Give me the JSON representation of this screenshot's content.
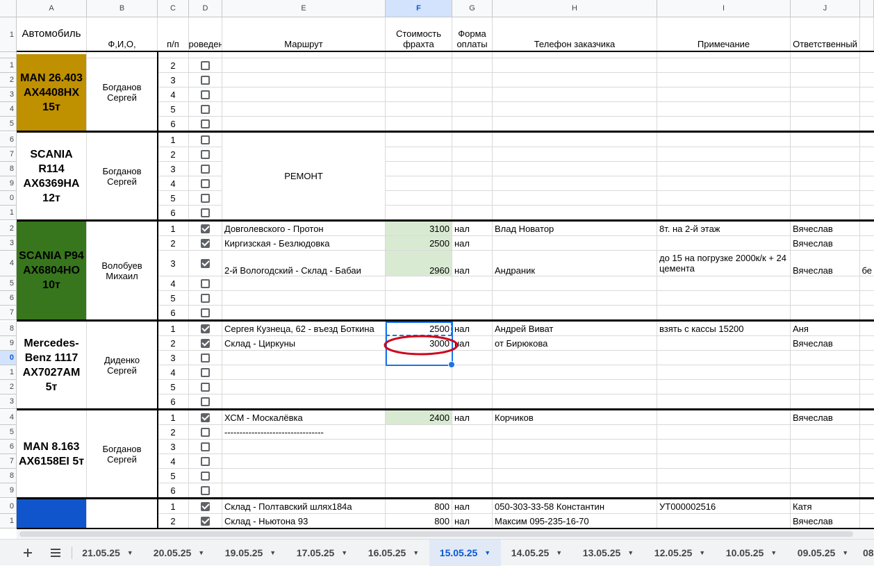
{
  "columns": [
    "A",
    "B",
    "C",
    "D",
    "E",
    "F",
    "G",
    "H",
    "I",
    "J"
  ],
  "selected_column": "F",
  "header": {
    "a": "Автомобиль",
    "b": "Ф,И,О,",
    "c": "п/п",
    "d": "Проведено",
    "e": "Маршрут",
    "f": "Стоимость фрахта",
    "g": "Форма оплаты",
    "h": "Телефон заказчика",
    "i": "Примечание",
    "j": "Ответственный",
    "row_label": "1"
  },
  "row_numbers": [
    "1",
    "1",
    "2",
    "3",
    "4",
    "5",
    "6",
    "7",
    "8",
    "9",
    "0",
    "1",
    "2",
    "3",
    "4",
    "5",
    "6",
    "7",
    "8",
    "9",
    "0",
    "1",
    "2",
    "3",
    "4",
    "5",
    "6",
    "7",
    "8",
    "9",
    "0",
    "1",
    "2"
  ],
  "selected_row_label": "0",
  "groups": [
    {
      "vehicle": "MAN 26.403 АХ4408НХ 15т",
      "vehicle_color": "#bf9000",
      "driver": "Богданов Сергей",
      "rows": [
        {
          "n": "2",
          "done": false,
          "route": "",
          "cost": "",
          "pay": "",
          "phone": "",
          "note": "",
          "resp": ""
        },
        {
          "n": "3",
          "done": false,
          "route": "",
          "cost": "",
          "pay": "",
          "phone": "",
          "note": "",
          "resp": ""
        },
        {
          "n": "4",
          "done": false,
          "route": "",
          "cost": "",
          "pay": "",
          "phone": "",
          "note": "",
          "resp": ""
        },
        {
          "n": "5",
          "done": false,
          "route": "",
          "cost": "",
          "pay": "",
          "phone": "",
          "note": "",
          "resp": ""
        },
        {
          "n": "6",
          "done": false,
          "route": "",
          "cost": "",
          "pay": "",
          "phone": "",
          "note": "",
          "resp": ""
        }
      ]
    },
    {
      "vehicle": "SCANIA R114 АХ6369НА 12т",
      "vehicle_color": "#ffffff",
      "driver": "Богданов Сергей",
      "merged_route": "РЕМОНТ",
      "rows": [
        {
          "n": "1",
          "done": false,
          "cost": "",
          "pay": "",
          "phone": "",
          "note": "",
          "resp": ""
        },
        {
          "n": "2",
          "done": false,
          "cost": "",
          "pay": "",
          "phone": "",
          "note": "",
          "resp": ""
        },
        {
          "n": "3",
          "done": false,
          "cost": "",
          "pay": "",
          "phone": "",
          "note": "",
          "resp": ""
        },
        {
          "n": "4",
          "done": false,
          "cost": "",
          "pay": "",
          "phone": "",
          "note": "",
          "resp": ""
        },
        {
          "n": "5",
          "done": false,
          "cost": "",
          "pay": "",
          "phone": "",
          "note": "",
          "resp": ""
        },
        {
          "n": "6",
          "done": false,
          "cost": "",
          "pay": "",
          "phone": "",
          "note": "",
          "resp": ""
        }
      ]
    },
    {
      "vehicle": "SCANIA P94 АХ6804НО 10т",
      "vehicle_color": "#38761d",
      "driver": "Волобуев Михаил",
      "rows": [
        {
          "n": "1",
          "done": true,
          "route": "Довголевского - Протон",
          "cost": "3100",
          "pay": "нал",
          "phone": "Влад Новатор",
          "note": "8т. на 2-й этаж",
          "resp": "Вячеслав"
        },
        {
          "n": "2",
          "done": true,
          "route": "Киргизская - Безлюдовка",
          "cost": "2500",
          "pay": "нал",
          "phone": "",
          "note": "",
          "resp": "Вячеслав"
        },
        {
          "n": "3",
          "done": true,
          "route": "2-й Вологодский - Склад - Бабаи",
          "cost": "2960",
          "pay": "нал",
          "phone": "Андраник",
          "note": "до 15 на погрузке 2000к/к + 24 цемента",
          "resp": "Вячеслав",
          "overflow": "бе"
        },
        {
          "n": "4",
          "done": false,
          "route": "",
          "cost": "",
          "pay": "",
          "phone": "",
          "note": "",
          "resp": ""
        },
        {
          "n": "5",
          "done": false,
          "route": "",
          "cost": "",
          "pay": "",
          "phone": "",
          "note": "",
          "resp": ""
        },
        {
          "n": "6",
          "done": false,
          "route": "",
          "cost": "",
          "pay": "",
          "phone": "",
          "note": "",
          "resp": ""
        }
      ]
    },
    {
      "vehicle": "Mercedes-Benz 1117 АХ7027АМ 5т",
      "vehicle_color": "#ffffff",
      "driver": "Диденко Сергей",
      "rows": [
        {
          "n": "1",
          "done": true,
          "route": "Сергея Кузнеца, 62 - въезд Боткина",
          "cost": "2500",
          "pay": "нал",
          "phone": "Андрей Виват",
          "note": "взять с кассы 15200",
          "resp": "Аня"
        },
        {
          "n": "2",
          "done": true,
          "route": "Склад - Циркуны",
          "cost": "3000",
          "pay": "нал",
          "phone": "от Бирюкова",
          "note": "",
          "resp": "Вячеслав"
        },
        {
          "n": "3",
          "done": false,
          "route": "",
          "cost": "",
          "pay": "",
          "phone": "",
          "note": "",
          "resp": ""
        },
        {
          "n": "4",
          "done": false,
          "route": "",
          "cost": "",
          "pay": "",
          "phone": "",
          "note": "",
          "resp": ""
        },
        {
          "n": "5",
          "done": false,
          "route": "",
          "cost": "",
          "pay": "",
          "phone": "",
          "note": "",
          "resp": ""
        },
        {
          "n": "6",
          "done": false,
          "route": "",
          "cost": "",
          "pay": "",
          "phone": "",
          "note": "",
          "resp": ""
        }
      ]
    },
    {
      "vehicle": "MAN 8.163 АХ6158ЕІ 5т",
      "vehicle_color": "#ffffff",
      "driver": "Богданов Сергей",
      "rows": [
        {
          "n": "1",
          "done": true,
          "route": "ХСМ - Москалёвка",
          "cost": "2400",
          "pay": "нал",
          "phone": "Корчиков",
          "note": "",
          "resp": "Вячеслав"
        },
        {
          "n": "2",
          "done": false,
          "route": "---------------------------------",
          "cost": "",
          "pay": "",
          "phone": "",
          "note": "",
          "resp": ""
        },
        {
          "n": "3",
          "done": false,
          "route": "",
          "cost": "",
          "pay": "",
          "phone": "",
          "note": "",
          "resp": ""
        },
        {
          "n": "4",
          "done": false,
          "route": "",
          "cost": "",
          "pay": "",
          "phone": "",
          "note": "",
          "resp": ""
        },
        {
          "n": "5",
          "done": false,
          "route": "",
          "cost": "",
          "pay": "",
          "phone": "",
          "note": "",
          "resp": ""
        },
        {
          "n": "6",
          "done": false,
          "route": "",
          "cost": "",
          "pay": "",
          "phone": "",
          "note": "",
          "resp": ""
        }
      ]
    },
    {
      "vehicle": "",
      "vehicle_color": "#1155cc",
      "driver": "",
      "rows": [
        {
          "n": "1",
          "done": true,
          "route": "Склад - Полтавский шлях184а",
          "cost": "800",
          "pay": "нал",
          "phone": "050-303-33-58 Константин",
          "note": "УТ000002516",
          "resp": "Катя"
        },
        {
          "n": "2",
          "done": true,
          "route": "Склад - Ньютона 93",
          "cost": "800",
          "pay": "нал",
          "phone": "Максим 095-235-16-70",
          "note": "",
          "resp": "Вячеслав"
        }
      ]
    }
  ],
  "tabs": [
    "21.05.25",
    "20.05.25",
    "19.05.25",
    "17.05.25",
    "16.05.25",
    "15.05.25",
    "14.05.25",
    "13.05.25",
    "12.05.25",
    "10.05.25",
    "09.05.25",
    "08"
  ],
  "active_tab": "15.05.25",
  "tab_icons": {
    "add": "plus-icon",
    "list": "sheet-list-icon"
  },
  "colors": {
    "green_cost": "#d9ead3",
    "selection": "#1a73e8",
    "annotation": "#d0021b"
  }
}
